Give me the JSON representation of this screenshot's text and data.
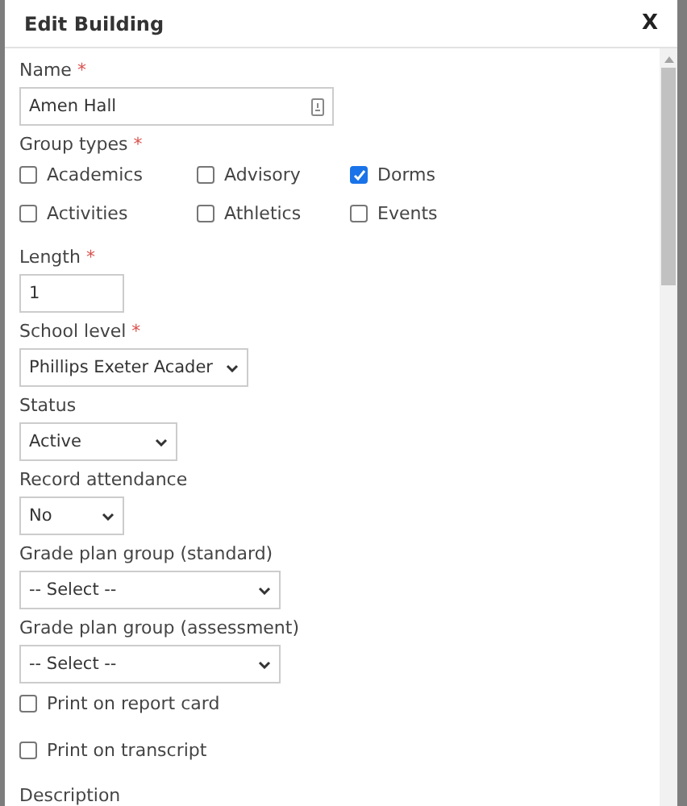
{
  "dialog": {
    "title": "Edit Building",
    "close": "X"
  },
  "fields": [
    {
      "kind": "text",
      "label": "Name",
      "marker": "*",
      "value": "Amen Hall"
    },
    {
      "kind": "checkgroup",
      "label": "Group types",
      "marker": "*",
      "options": [
        {
          "label": "Academics",
          "checked": false
        },
        {
          "label": "Advisory",
          "checked": false
        },
        {
          "label": "Dorms",
          "checked": true
        },
        {
          "label": "Activities",
          "checked": false
        },
        {
          "label": "Athletics",
          "checked": false
        },
        {
          "label": "Events",
          "checked": false
        }
      ]
    },
    {
      "kind": "text",
      "label": "Length",
      "marker": "*",
      "value": "1"
    },
    {
      "kind": "select",
      "label": "School level",
      "marker": "*",
      "value": "Phillips Exeter Acader"
    },
    {
      "kind": "select",
      "label": "Status",
      "value": "Active"
    },
    {
      "kind": "select",
      "label": "Record attendance",
      "value": "No"
    },
    {
      "kind": "select",
      "label": "Grade plan group (standard)",
      "value": "-- Select --"
    },
    {
      "kind": "select",
      "label": "Grade plan group (assessment)",
      "value": "-- Select --"
    },
    {
      "kind": "checkbox",
      "label": "Print on report card",
      "checked": false
    },
    {
      "kind": "checkbox",
      "label": "Print on transcript",
      "checked": false
    },
    {
      "kind": "label",
      "label": "Description"
    }
  ]
}
